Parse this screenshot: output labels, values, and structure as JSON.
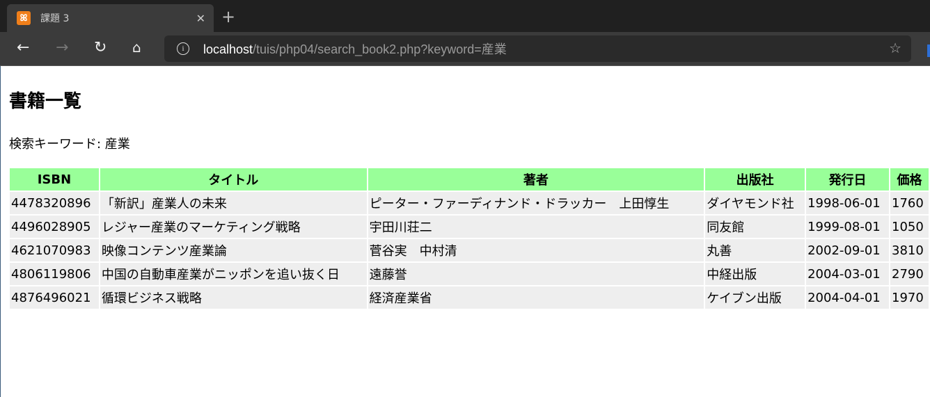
{
  "browser": {
    "tab_title": "課題 3",
    "url_host": "localhost",
    "url_path": "/tuis/php04/search_book2.php?keyword=産業",
    "icons": [
      "back-icon",
      "forward-icon",
      "refresh-icon",
      "home-icon",
      "info-icon",
      "favorite-add-icon",
      "close-icon",
      "plus-icon"
    ]
  },
  "page": {
    "heading": "書籍一覧",
    "keyword_label": "検索キーワード: 産業",
    "table": {
      "headers": [
        "ISBN",
        "タイトル",
        "著者",
        "出版社",
        "発行日",
        "価格"
      ],
      "rows": [
        [
          "4478320896",
          "「新訳」産業人の未来",
          "ピーター・ファーディナンド・ドラッカー　上田惇生",
          "ダイヤモンド社",
          "1998-06-01",
          "1760"
        ],
        [
          "4496028905",
          "レジャー産業のマーケティング戦略",
          "宇田川荘二",
          "同友館",
          "1999-08-01",
          "1050"
        ],
        [
          "4621070983",
          "映像コンテンツ産業論",
          "菅谷実　中村清",
          "丸善",
          "2002-09-01",
          "3810"
        ],
        [
          "4806119806",
          "中国の自動車産業がニッポンを追い抜く日",
          "遠藤誉",
          "中経出版",
          "2004-03-01",
          "2790"
        ],
        [
          "4876496021",
          "循環ビジネス戦略",
          "経済産業省",
          "ケイブン出版",
          "2004-04-01",
          "1970"
        ]
      ]
    }
  }
}
